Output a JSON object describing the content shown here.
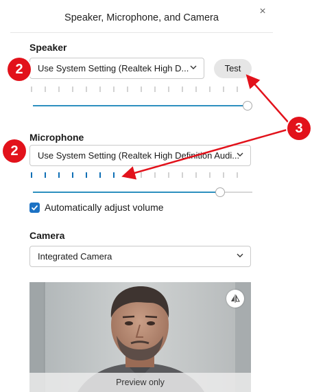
{
  "dialog": {
    "title": "Speaker, Microphone, and Camera",
    "close_glyph": "×"
  },
  "speaker": {
    "label": "Speaker",
    "selected": "Use System Setting (Realtek High D...",
    "test_label": "Test",
    "meter_active_ticks": 0,
    "meter_total_ticks": 16,
    "volume": 1.0
  },
  "microphone": {
    "label": "Microphone",
    "selected": "Use System Setting (Realtek High Definition Audi...",
    "meter_active_ticks": 8,
    "meter_total_ticks": 16,
    "volume": 0.87,
    "auto_adjust_label": "Automatically adjust volume",
    "auto_adjust_checked": true
  },
  "camera": {
    "label": "Camera",
    "selected": "Integrated Camera",
    "preview_caption": "Preview only"
  },
  "annotations": {
    "badge_2": "2",
    "badge_3": "3",
    "color": "#e2121b"
  },
  "icons": {
    "close": "close-icon",
    "dropdown": "chevron-down-icon",
    "check": "checkmark-icon",
    "flip": "mirror-flip-icon"
  },
  "colors": {
    "accent_blue": "#1c72c4",
    "meter_active": "#0f6fb5",
    "slider_fill": "#2c8fbf",
    "annotation_red": "#e2121b"
  }
}
